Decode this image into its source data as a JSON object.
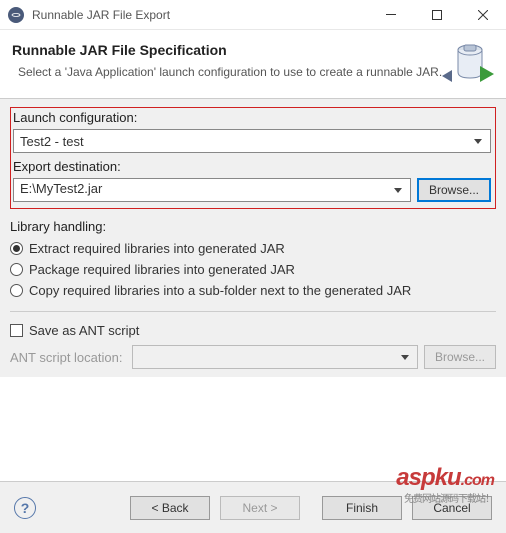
{
  "window": {
    "title": "Runnable JAR File Export"
  },
  "header": {
    "title": "Runnable JAR File Specification",
    "description": "Select a 'Java Application' launch configuration to use to create a runnable JAR."
  },
  "launch_config": {
    "label": "Launch configuration:",
    "value": "Test2 - test"
  },
  "export_dest": {
    "label": "Export destination:",
    "value": "E:\\MyTest2.jar",
    "browse": "Browse..."
  },
  "library_handling": {
    "label": "Library handling:",
    "options": [
      "Extract required libraries into generated JAR",
      "Package required libraries into generated JAR",
      "Copy required libraries into a sub-folder next to the generated JAR"
    ],
    "selected": 0
  },
  "ant": {
    "checkbox_label": "Save as ANT script",
    "location_label": "ANT script location:",
    "browse": "Browse..."
  },
  "footer": {
    "back": "< Back",
    "next": "Next >",
    "finish": "Finish",
    "cancel": "Cancel"
  },
  "watermark": {
    "main": "aspku",
    "suffix": ".com",
    "sub": "免费网站源码下载站！"
  }
}
